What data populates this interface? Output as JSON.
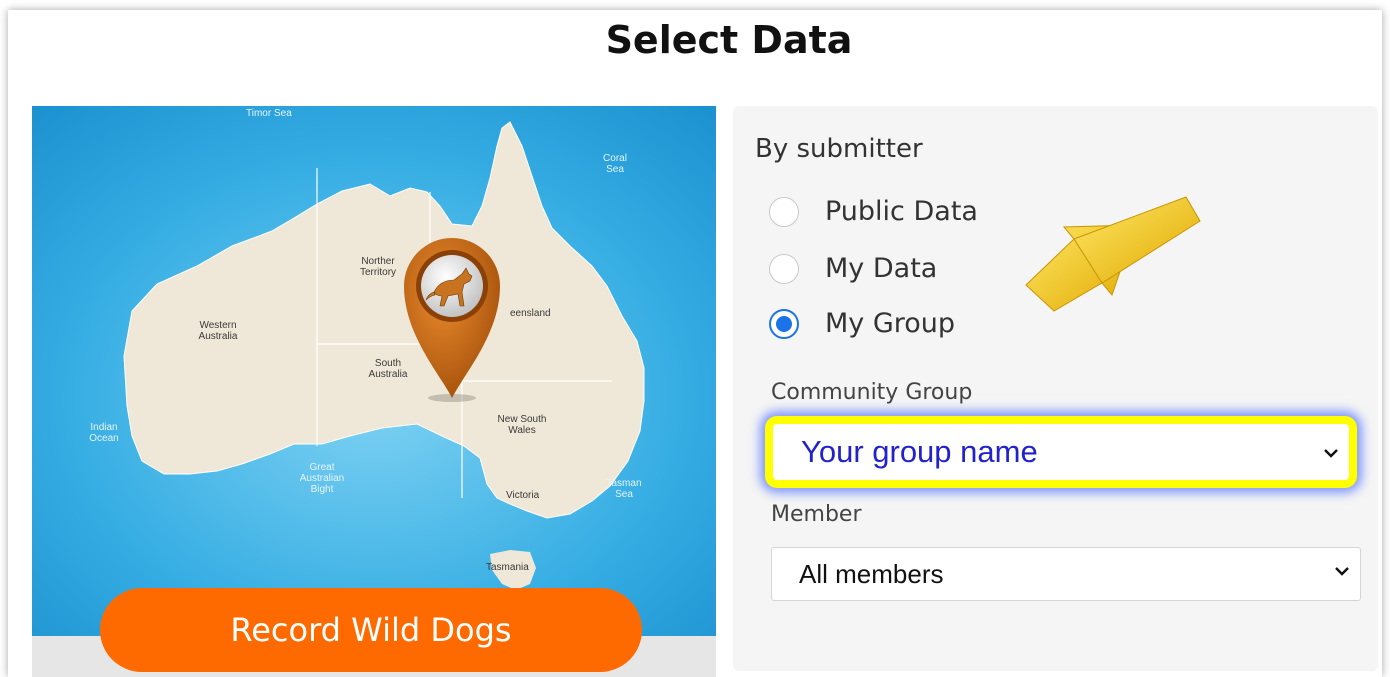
{
  "page": {
    "title": "Select Data"
  },
  "map": {
    "labels": {
      "timor_sea": "Timor Sea",
      "coral_sea": "Coral Sea",
      "northern_territory": "Norther Territory",
      "western_australia": "Western Australia",
      "queensland": "eensland",
      "south_australia": "South Australia",
      "indian_ocean": "Indian Ocean",
      "new_south_wales": "New South Wales",
      "great_australian_bight": "Great Australian Bight",
      "victoria": "Victoria",
      "tasman_sea": "Tasman Sea",
      "tasmania": "Tasmania"
    },
    "pin_icon": "dingo-pin-icon",
    "record_button": "Record Wild Dogs",
    "colors": {
      "ocean": "#29a8e0",
      "land": "#efe8d8",
      "pin": "#c7620f",
      "button": "#ff6a00"
    }
  },
  "filters": {
    "heading": "By submitter",
    "options": [
      {
        "label": "Public Data",
        "checked": false
      },
      {
        "label": "My Data",
        "checked": false
      },
      {
        "label": "My Group",
        "checked": true
      }
    ],
    "community_group": {
      "label": "Community Group",
      "value": "Your group name"
    },
    "member": {
      "label": "Member",
      "value": "All members"
    }
  },
  "annotations": {
    "arrow_color": "#f5c400",
    "highlight_color": "#ffff00",
    "glow_color": "#5a78ff"
  }
}
